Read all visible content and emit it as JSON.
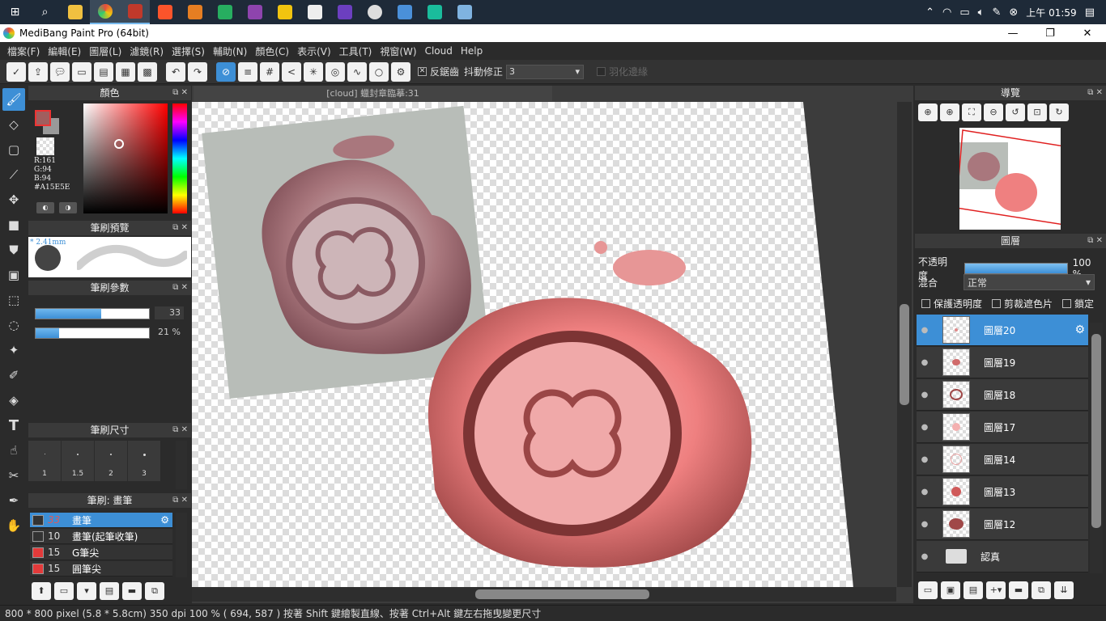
{
  "taskbar": {
    "tray_time": "上午 01:59"
  },
  "window": {
    "title": "MediBang Paint Pro (64bit)",
    "minimize": "—",
    "maximize": "❐",
    "close": "✕"
  },
  "menu": [
    "檔案(F)",
    "編輯(E)",
    "圖層(L)",
    "濾鏡(R)",
    "選擇(S)",
    "輔助(N)",
    "顏色(C)",
    "表示(V)",
    "工具(T)",
    "視窗(W)",
    "Cloud",
    "Help"
  ],
  "toolbar": {
    "antialias_label": "反鋸齒",
    "stabilizer_label": "抖動修正",
    "stabilizer_value": "3",
    "feather_label": "羽化邊緣"
  },
  "panels": {
    "color": {
      "title": "顏色",
      "r": "R:161",
      "g": "G:94",
      "b": "B:94",
      "hex": "#A15E5E"
    },
    "brush_preview": {
      "title": "筆刷預覽",
      "size_label": "* 2.41mm"
    },
    "brush_params": {
      "title": "筆刷參數",
      "size_value": "33",
      "size_fraction": 0.58,
      "opacity_value": "21 %",
      "opacity_fraction": 0.21
    },
    "brush_size": {
      "title": "筆刷尺寸",
      "sizes": [
        "1",
        "1.5",
        "2",
        "3"
      ]
    },
    "brush_list": {
      "title": "筆刷: 畫筆",
      "items": [
        {
          "num": "33",
          "name": "畫筆",
          "color": "#333333"
        },
        {
          "num": "10",
          "name": "畫筆(起筆收筆)",
          "color": "#333333"
        },
        {
          "num": "15",
          "name": "G筆尖",
          "color": "#e33a3a"
        },
        {
          "num": "15",
          "name": "圓筆尖",
          "color": "#e33a3a"
        }
      ]
    },
    "navigator": {
      "title": "導覽"
    },
    "layers": {
      "title": "圖層",
      "opacity_label": "不透明度",
      "opacity_value": "100 %",
      "blend_label": "混合",
      "blend_value": "正常",
      "protect_label": "保護透明度",
      "clip_label": "剪裁遮色片",
      "lock_label": "鎖定",
      "items": [
        {
          "name": "圖層20"
        },
        {
          "name": "圖層19"
        },
        {
          "name": "圖層18"
        },
        {
          "name": "圖層17"
        },
        {
          "name": "圖層14"
        },
        {
          "name": "圖層13"
        },
        {
          "name": "圖層12"
        },
        {
          "name": "認真"
        }
      ]
    }
  },
  "canvas": {
    "tab_title": "[cloud] 蠟封章臨摹:31"
  },
  "status": {
    "text": "800 * 800 pixel   (5.8 * 5.8cm)   350 dpi   100 %   ( 694, 587 )   按著 Shift 鍵繪製直線、按著 Ctrl+Alt 鍵左右拖曳變更尺寸"
  }
}
